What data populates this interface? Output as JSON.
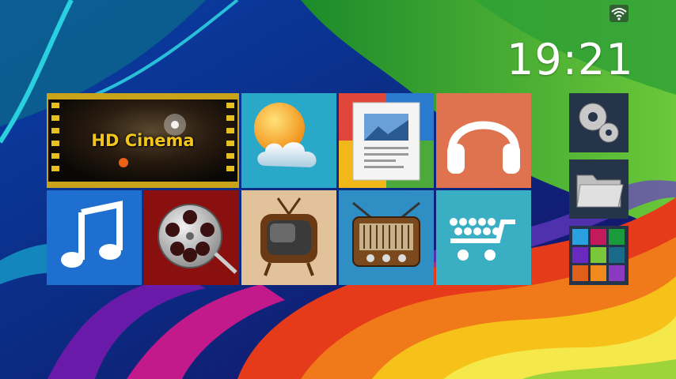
{
  "status_bar": {
    "wifi_icon": "wifi-icon",
    "time": "19:21"
  },
  "tiles": {
    "hd_cinema": {
      "label": "HD Cinema",
      "icon": "film-strip-icon"
    },
    "weather": {
      "icon": "weather-sun-cloud-icon"
    },
    "gallery": {
      "icon": "picture-document-icon"
    },
    "music": {
      "icon": "headphones-icon"
    },
    "music_player": {
      "icon": "music-note-icon"
    },
    "video": {
      "icon": "film-reel-icon"
    },
    "tv": {
      "icon": "retro-tv-icon"
    },
    "radio": {
      "icon": "vintage-radio-icon"
    },
    "store": {
      "icon": "shopping-cart-icon"
    }
  },
  "side_buttons": {
    "settings": {
      "icon": "gear-icon"
    },
    "file_manager": {
      "icon": "folder-icon"
    },
    "all_apps": {
      "icon": "app-grid-icon"
    }
  },
  "colors": {
    "weather_bg": "#2aa8c8",
    "music_bg": "#e0734f",
    "music_player_bg": "#1f6fd0",
    "video_bg": "#8a1010",
    "tv_bg": "#e2c29a",
    "radio_bg": "#2f8fc4",
    "store_bg": "#3aaec2",
    "side_bg": "#26344a"
  }
}
